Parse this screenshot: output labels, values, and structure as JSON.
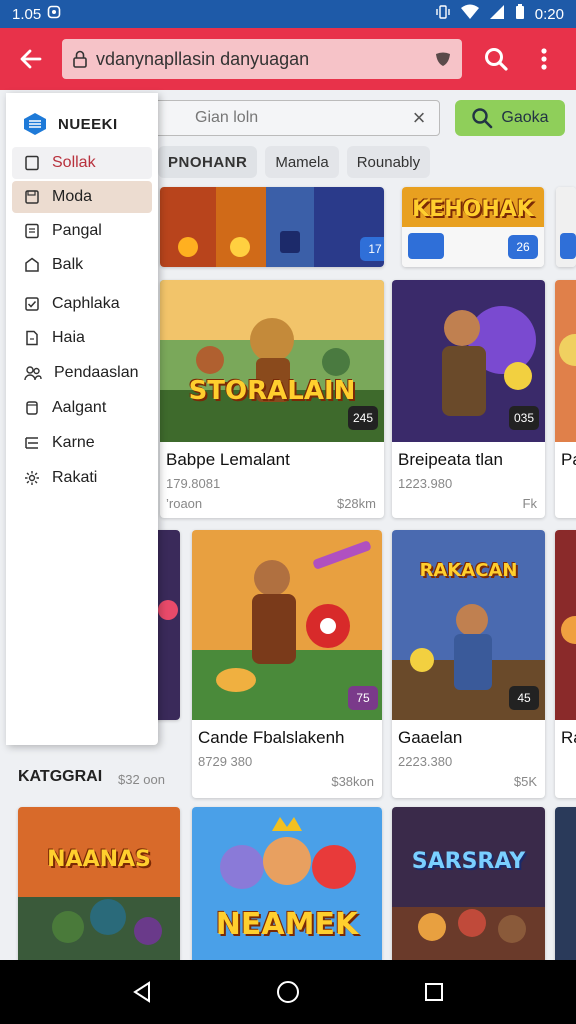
{
  "status_bar": {
    "time_left": "1.05",
    "time_right": "0:20",
    "icons": [
      "notification-icon",
      "vibrate-icon",
      "wifi-icon",
      "signal-icon",
      "battery-icon"
    ]
  },
  "app_bar": {
    "url": "vdanynapllasin danyuagan",
    "icons": [
      "back-arrow-icon",
      "lock-icon",
      "shield-icon",
      "search-icon",
      "more-vert-icon"
    ]
  },
  "search": {
    "placeholder": "Gian loln",
    "button_label": "Gaoka"
  },
  "chips": [
    "PNOHANR",
    "Mamela",
    "Rounably"
  ],
  "drawer": {
    "brand": "NUEEKI",
    "items": [
      {
        "label": "Sollak",
        "icon": "checkbox-icon"
      },
      {
        "label": "Moda",
        "icon": "save-icon"
      },
      {
        "label": "Pangal",
        "icon": "document-icon"
      },
      {
        "label": "Balk",
        "icon": "tag-icon"
      },
      {
        "label": "Caphlaka",
        "icon": "check-square-icon"
      },
      {
        "label": "Haia",
        "icon": "file-icon"
      },
      {
        "label": "Pendaaslan",
        "icon": "people-icon"
      },
      {
        "label": "Aalgant",
        "icon": "cylinder-icon"
      },
      {
        "label": "Karne",
        "icon": "filter-icon"
      },
      {
        "label": "Rakati",
        "icon": "settings-icon"
      }
    ]
  },
  "cards": {
    "top_row": {
      "badge_left": "17",
      "badge_right": "26",
      "art_text": "KEHOHAK"
    },
    "row1": [
      {
        "title": "Babpe Lemalant",
        "meta": "179.8081",
        "price": "$28km",
        "left_meta": "’roaon",
        "badge": "245",
        "art_text": "STORALAIN"
      },
      {
        "title": "Breipeata tlan",
        "meta": "1223.980",
        "price": "Fk",
        "badge": "035",
        "art_text": ""
      },
      {
        "title": "Pa",
        "meta": "",
        "price": "",
        "badge": "",
        "art_text": ""
      }
    ],
    "row2": [
      {
        "title": "Cande Fbalslakenh",
        "meta": "8729 380",
        "price": "$38kon",
        "badge": "75",
        "art_text": ""
      },
      {
        "title": "Gaaelan",
        "meta": "2223.380",
        "price": "$5K",
        "badge": "45",
        "art_text": "RAKACAN"
      },
      {
        "title": "Ra",
        "meta": "",
        "price": "",
        "badge": "",
        "art_text": ""
      }
    ],
    "row3": [
      {
        "art_text": "NAANAS"
      },
      {
        "art_text": "NEAMEK"
      },
      {
        "art_text": "SARSRAY"
      }
    ]
  },
  "section": {
    "label": "KATGGRAI",
    "meta": "$32 oon"
  },
  "colors": {
    "status_bar": "#1e5aa8",
    "app_bar": "#e8324a",
    "url_box": "#f6c3c8",
    "search_button": "#8fcf5a",
    "selected_drawer_text": "#b8313d"
  },
  "nav_bar": {
    "icons": [
      "back-triangle-icon",
      "home-circle-icon",
      "recents-square-icon"
    ]
  }
}
